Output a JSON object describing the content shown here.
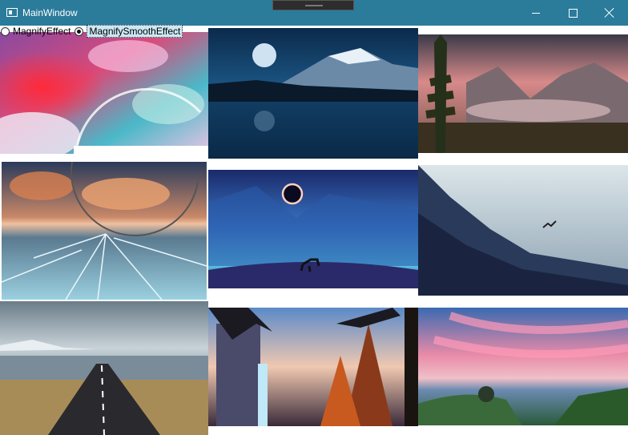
{
  "window": {
    "title": "MainWindow",
    "icons": {
      "app": "window-app-icon",
      "minimize": "minimize-icon",
      "maximize": "maximize-icon",
      "close": "close-icon"
    },
    "colors": {
      "titlebar": "#2b7b9b"
    }
  },
  "effects": [
    {
      "label": "MagnifyEffect",
      "checked": false
    },
    {
      "label": "MagnifySmoothEffect",
      "checked": true
    }
  ],
  "images": [
    "cosmic-clouds-image",
    "moon-over-lake-image",
    "mountain-sunset-forest-image",
    "frozen-lake-sunset-image",
    "eclipse-deer-image",
    "misty-mountain-bird-image",
    "coastal-road-image",
    "forest-waterfall-image",
    "pink-sky-coast-image"
  ]
}
